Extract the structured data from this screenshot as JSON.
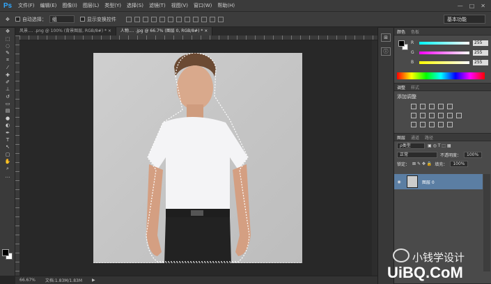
{
  "app": {
    "logo": "Ps"
  },
  "menu": [
    "文件(F)",
    "编辑(E)",
    "图像(I)",
    "图层(L)",
    "类型(Y)",
    "选择(S)",
    "滤镜(T)",
    "视图(V)",
    "窗口(W)",
    "帮助(H)"
  ],
  "window_controls": [
    "—",
    "□",
    "✕"
  ],
  "options": {
    "auto_select_label": "自动选择：",
    "auto_select_value": "组",
    "transform_label": "显示变换控件"
  },
  "workspace": "基本功能",
  "tabs": [
    {
      "label": "风景.... .png @ 100% (背景图层, RGB/8#) *  ×"
    },
    {
      "label": "人物.... .jpg @ 66.7% (图层 0, RGB/8#) *  ×"
    }
  ],
  "status": {
    "zoom": "66.67%",
    "doc": "文档:1.83M/1.83M"
  },
  "color_panel": {
    "tabs": [
      "颜色",
      "色板"
    ],
    "channels": [
      {
        "label": "R",
        "value": "255"
      },
      {
        "label": "G",
        "value": "255"
      },
      {
        "label": "B",
        "value": "255"
      }
    ]
  },
  "adjust_panel": {
    "tabs": [
      "调整",
      "样式"
    ],
    "title": "添加调整"
  },
  "layers_panel": {
    "tabs": [
      "图层",
      "通道",
      "路径"
    ],
    "kind": "ρ类型",
    "blend": "正常",
    "opacity_label": "不透明度：",
    "opacity": "100%",
    "lock_label": "锁定：",
    "fill_label": "填充：",
    "fill": "100%",
    "layer_name": "图层 0"
  },
  "watermark": {
    "cn": "小钱学设计",
    "en": "UiBQ.CoM"
  },
  "colors": {
    "accent": "#5b7ea3",
    "ps_blue": "#31a8ff"
  }
}
